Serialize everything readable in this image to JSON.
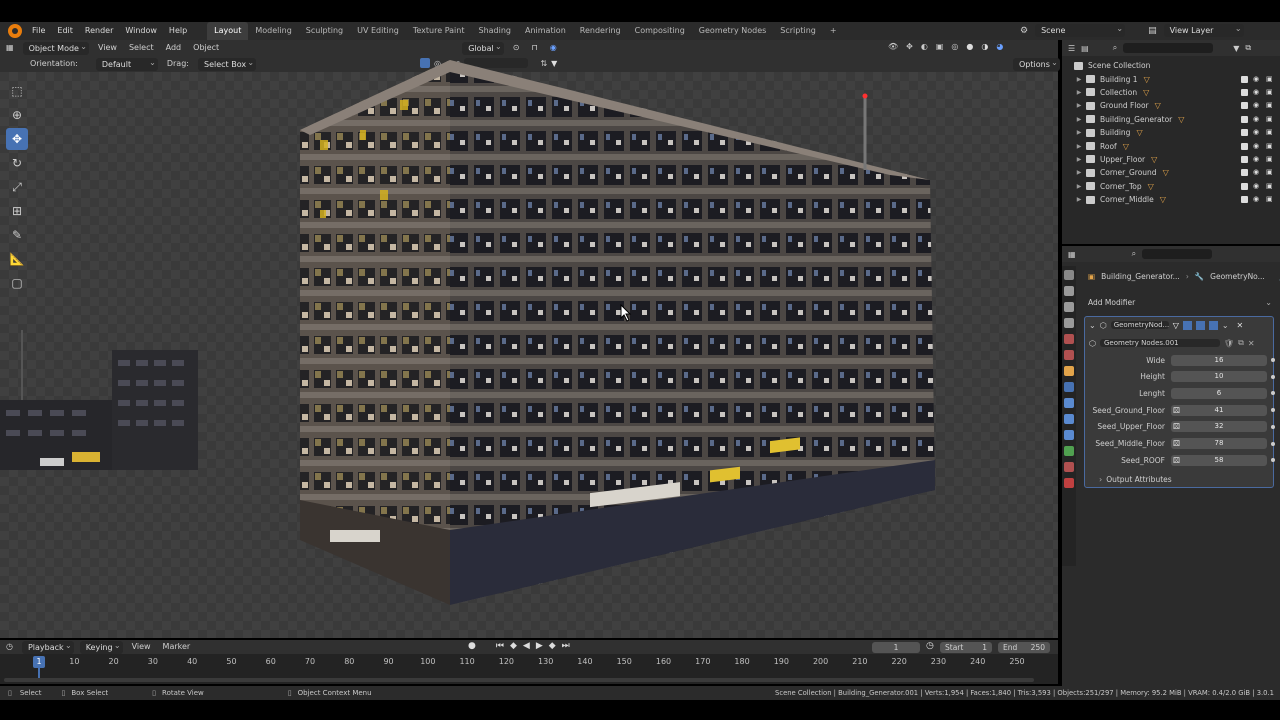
{
  "menu": {
    "items": [
      "File",
      "Edit",
      "Render",
      "Window",
      "Help"
    ],
    "workspaces": [
      "Layout",
      "Modeling",
      "Sculpting",
      "UV Editing",
      "Texture Paint",
      "Shading",
      "Animation",
      "Rendering",
      "Compositing",
      "Geometry Nodes",
      "Scripting"
    ],
    "active_workspace": "Layout",
    "scene": "Scene",
    "view_layer": "View Layer"
  },
  "viewport_header": {
    "mode": "Object Mode",
    "view": "View",
    "select": "Select",
    "add": "Add",
    "object": "Object",
    "transform": "Global",
    "orientation_label": "Orientation:",
    "orientation_value": "Default",
    "drag_label": "Drag:",
    "drag_value": "Select Box",
    "options": "Options"
  },
  "outliner": {
    "root": "Scene Collection",
    "items": [
      {
        "label": "Building 1"
      },
      {
        "label": "Collection"
      },
      {
        "label": "Ground Floor"
      },
      {
        "label": "Building_Generator"
      },
      {
        "label": "Building"
      },
      {
        "label": "Roof"
      },
      {
        "label": "Upper_Floor"
      },
      {
        "label": "Corner_Ground"
      },
      {
        "label": "Corner_Top"
      },
      {
        "label": "Corner_Middle"
      }
    ]
  },
  "properties": {
    "breadcrumb_object": "Building_Generator...",
    "breadcrumb_modifier": "GeometryNo...",
    "add_modifier": "Add Modifier",
    "modifier_name": "GeometryNod...",
    "node_group": "Geometry Nodes.001",
    "fields": [
      {
        "label": "Wide",
        "value": "16",
        "seed": false
      },
      {
        "label": "Height",
        "value": "10",
        "seed": false
      },
      {
        "label": "Lenght",
        "value": "6",
        "seed": false
      },
      {
        "label": "Seed_Ground_Floor",
        "value": "41",
        "seed": true
      },
      {
        "label": "Seed_Upper_Floor",
        "value": "32",
        "seed": true
      },
      {
        "label": "Seed_Middle_Floor",
        "value": "78",
        "seed": true
      },
      {
        "label": "Seed_ROOF",
        "value": "58",
        "seed": true
      }
    ],
    "output_attributes": "Output Attributes"
  },
  "timeline": {
    "playback": "Playback",
    "keying": "Keying",
    "view": "View",
    "marker": "Marker",
    "current_frame": "1",
    "start_label": "Start",
    "start": "1",
    "end_label": "End",
    "end": "250",
    "ticks": [
      "1",
      "10",
      "20",
      "30",
      "40",
      "50",
      "60",
      "70",
      "80",
      "90",
      "100",
      "110",
      "120",
      "130",
      "140",
      "150",
      "160",
      "170",
      "180",
      "190",
      "200",
      "210",
      "220",
      "230",
      "240",
      "250"
    ]
  },
  "statusbar": {
    "select": "Select",
    "box_select": "Box Select",
    "rotate_view": "Rotate View",
    "context_menu": "Object Context Menu",
    "stats": "Scene Collection | Building_Generator.001 | Verts:1,954 | Faces:1,840 | Tris:3,593 | Objects:251/297 | Memory: 95.2 MiB | VRAM: 0.4/2.0 GiB | 3.0.1"
  }
}
